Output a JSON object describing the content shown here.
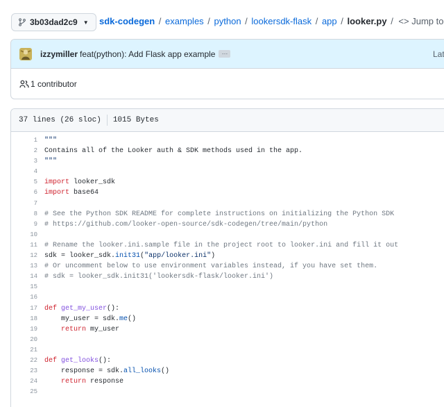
{
  "branch": {
    "name": "3b03dad2c9"
  },
  "breadcrumb": {
    "repo": "sdk-codegen",
    "parts": [
      "examples",
      "python",
      "lookersdk-flask",
      "app"
    ],
    "file": "looker.py",
    "jump_label": "Jump to"
  },
  "commit": {
    "author": "izzymiller",
    "message": "feat(python): Add Flask app example",
    "ellipsis": "…",
    "latest_label": "Latest c"
  },
  "contributors": {
    "label": "1 contributor"
  },
  "file_info": {
    "lines": "37 lines (26 sloc)",
    "size": "1015 Bytes"
  },
  "code_lines": [
    {
      "n": "1",
      "t": "\"\"\""
    },
    {
      "n": "2",
      "t": "Contains all of the Looker auth & SDK methods used in the app."
    },
    {
      "n": "3",
      "t": "\"\"\""
    },
    {
      "n": "4",
      "t": ""
    },
    {
      "n": "5",
      "t": "import looker_sdk"
    },
    {
      "n": "6",
      "t": "import base64"
    },
    {
      "n": "7",
      "t": ""
    },
    {
      "n": "8",
      "t": "# See the Python SDK README for complete instructions on initializing the Python SDK"
    },
    {
      "n": "9",
      "t": "# https://github.com/looker-open-source/sdk-codegen/tree/main/python"
    },
    {
      "n": "10",
      "t": ""
    },
    {
      "n": "11",
      "t": "# Rename the looker.ini.sample file in the project root to looker.ini and fill it out"
    },
    {
      "n": "12",
      "t": "sdk = looker_sdk.init31(\"app/looker.ini\")"
    },
    {
      "n": "13",
      "t": "# Or uncomment below to use environment variables instead, if you have set them."
    },
    {
      "n": "14",
      "t": "# sdk = looker_sdk.init31('lookersdk-flask/looker.ini')"
    },
    {
      "n": "15",
      "t": ""
    },
    {
      "n": "16",
      "t": ""
    },
    {
      "n": "17",
      "t": "def get_my_user():"
    },
    {
      "n": "18",
      "t": "    my_user = sdk.me()"
    },
    {
      "n": "19",
      "t": "    return my_user"
    },
    {
      "n": "20",
      "t": ""
    },
    {
      "n": "21",
      "t": ""
    },
    {
      "n": "22",
      "t": "def get_looks():"
    },
    {
      "n": "23",
      "t": "    response = sdk.all_looks()"
    },
    {
      "n": "24",
      "t": "    return response"
    },
    {
      "n": "25",
      "t": ""
    }
  ]
}
